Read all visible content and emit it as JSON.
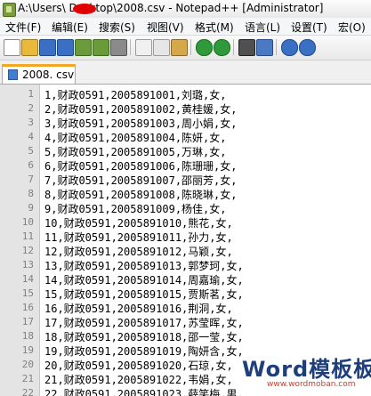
{
  "window": {
    "title": "A:\\Users\\ Desktop\\2008.csv - Notepad++ [Administrator]"
  },
  "menu": [
    "文件(F)",
    "编辑(E)",
    "搜索(S)",
    "视图(V)",
    "格式(M)",
    "语言(L)",
    "设置(T)",
    "宏(O)"
  ],
  "toolbar": {
    "buttons": [
      {
        "name": "new-file-icon",
        "color": "#ffffff"
      },
      {
        "name": "open-file-icon",
        "color": "#e8b93a"
      },
      {
        "name": "save-icon",
        "color": "#3a6fc4"
      },
      {
        "name": "save-all-icon",
        "color": "#3a6fc4"
      },
      {
        "name": "close-icon",
        "color": "#6a9a3a"
      },
      {
        "name": "close-all-icon",
        "color": "#6a9a3a"
      },
      {
        "name": "print-icon",
        "color": "#8a8a8a"
      },
      {
        "name": "cut-icon",
        "color": "#9a9a9a"
      },
      {
        "name": "copy-icon",
        "color": "#c7c7c7"
      },
      {
        "name": "paste-icon",
        "color": "#d6a84a"
      },
      {
        "name": "undo-icon",
        "color": "#2e9a3a"
      },
      {
        "name": "redo-icon",
        "color": "#2e9a3a"
      },
      {
        "name": "find-icon",
        "color": "#505050"
      },
      {
        "name": "replace-icon",
        "color": "#4a7ac4"
      },
      {
        "name": "zoom-in-icon",
        "color": "#3a6fc4"
      },
      {
        "name": "zoom-out-icon",
        "color": "#3a6fc4"
      }
    ]
  },
  "tab": {
    "label": "2008. csv"
  },
  "editor": {
    "lines": [
      {
        "num": "1",
        "text": "1,财政0591,2005891001,刘璐,女,"
      },
      {
        "num": "2",
        "text": "2,财政0591,2005891002,黄桂媛,女,"
      },
      {
        "num": "3",
        "text": "3,财政0591,2005891003,周小娟,女,"
      },
      {
        "num": "4",
        "text": "4,财政0591,2005891004,陈妍,女,"
      },
      {
        "num": "5",
        "text": "5,财政0591,2005891005,万琳,女,"
      },
      {
        "num": "6",
        "text": "6,财政0591,2005891006,陈珊珊,女,"
      },
      {
        "num": "7",
        "text": "7,财政0591,2005891007,邵丽芳,女,"
      },
      {
        "num": "8",
        "text": "8,财政0591,2005891008,陈晓琳,女,"
      },
      {
        "num": "9",
        "text": "9,财政0591,2005891009,杨佳,女,"
      },
      {
        "num": "10",
        "text": "10,财政0591,2005891010,熊花,女,"
      },
      {
        "num": "11",
        "text": "11,财政0591,2005891011,孙力,女,"
      },
      {
        "num": "12",
        "text": "12,财政0591,2005891012,马颖,女,"
      },
      {
        "num": "13",
        "text": "13,财政0591,2005891013,郭梦珂,女,"
      },
      {
        "num": "14",
        "text": "14,财政0591,2005891014,周嘉瑜,女,"
      },
      {
        "num": "15",
        "text": "15,财政0591,2005891015,贾斯茗,女,"
      },
      {
        "num": "16",
        "text": "16,财政0591,2005891016,荆洞,女,"
      },
      {
        "num": "17",
        "text": "17,财政0591,2005891017,苏莹晖,女,"
      },
      {
        "num": "18",
        "text": "18,财政0591,2005891018,邵一莹,女,"
      },
      {
        "num": "19",
        "text": "19,财政0591,2005891019,陶妍含,女,"
      },
      {
        "num": "20",
        "text": "20,财政0591,2005891020,石琼,女,"
      },
      {
        "num": "21",
        "text": "21,财政0591,2005891022,韦娟,女,"
      },
      {
        "num": "22",
        "text": "22,财政0591,2005891023,薛笑梅,男,"
      }
    ]
  },
  "watermark": {
    "main": "Word模板板",
    "sub": "www.wordmoban.com"
  }
}
